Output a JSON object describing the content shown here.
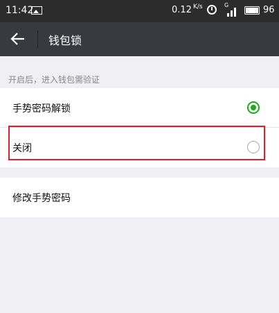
{
  "status_bar": {
    "time": "11:42",
    "speed": "0.12",
    "speed_unit": "K/s",
    "signal_label": "G",
    "battery": "96",
    "icons": [
      "image-icon",
      "alarm-icon",
      "signal-icon",
      "battery-icon"
    ]
  },
  "toolbar": {
    "back_icon": "arrow-left-icon",
    "title": "钱包锁"
  },
  "hint": "开启后，进入钱包需验证",
  "options": [
    {
      "label": "手势密码解锁",
      "selected": true
    },
    {
      "label": "关闭",
      "selected": false
    }
  ],
  "actions": [
    {
      "label": "修改手势密码"
    }
  ],
  "colors": {
    "status_bar_bg": "#2c2c2c",
    "toolbar_bg": "#393a3f",
    "page_bg": "#efeff4",
    "accent_green": "#1aad19",
    "highlight_red": "#e01e2c"
  }
}
